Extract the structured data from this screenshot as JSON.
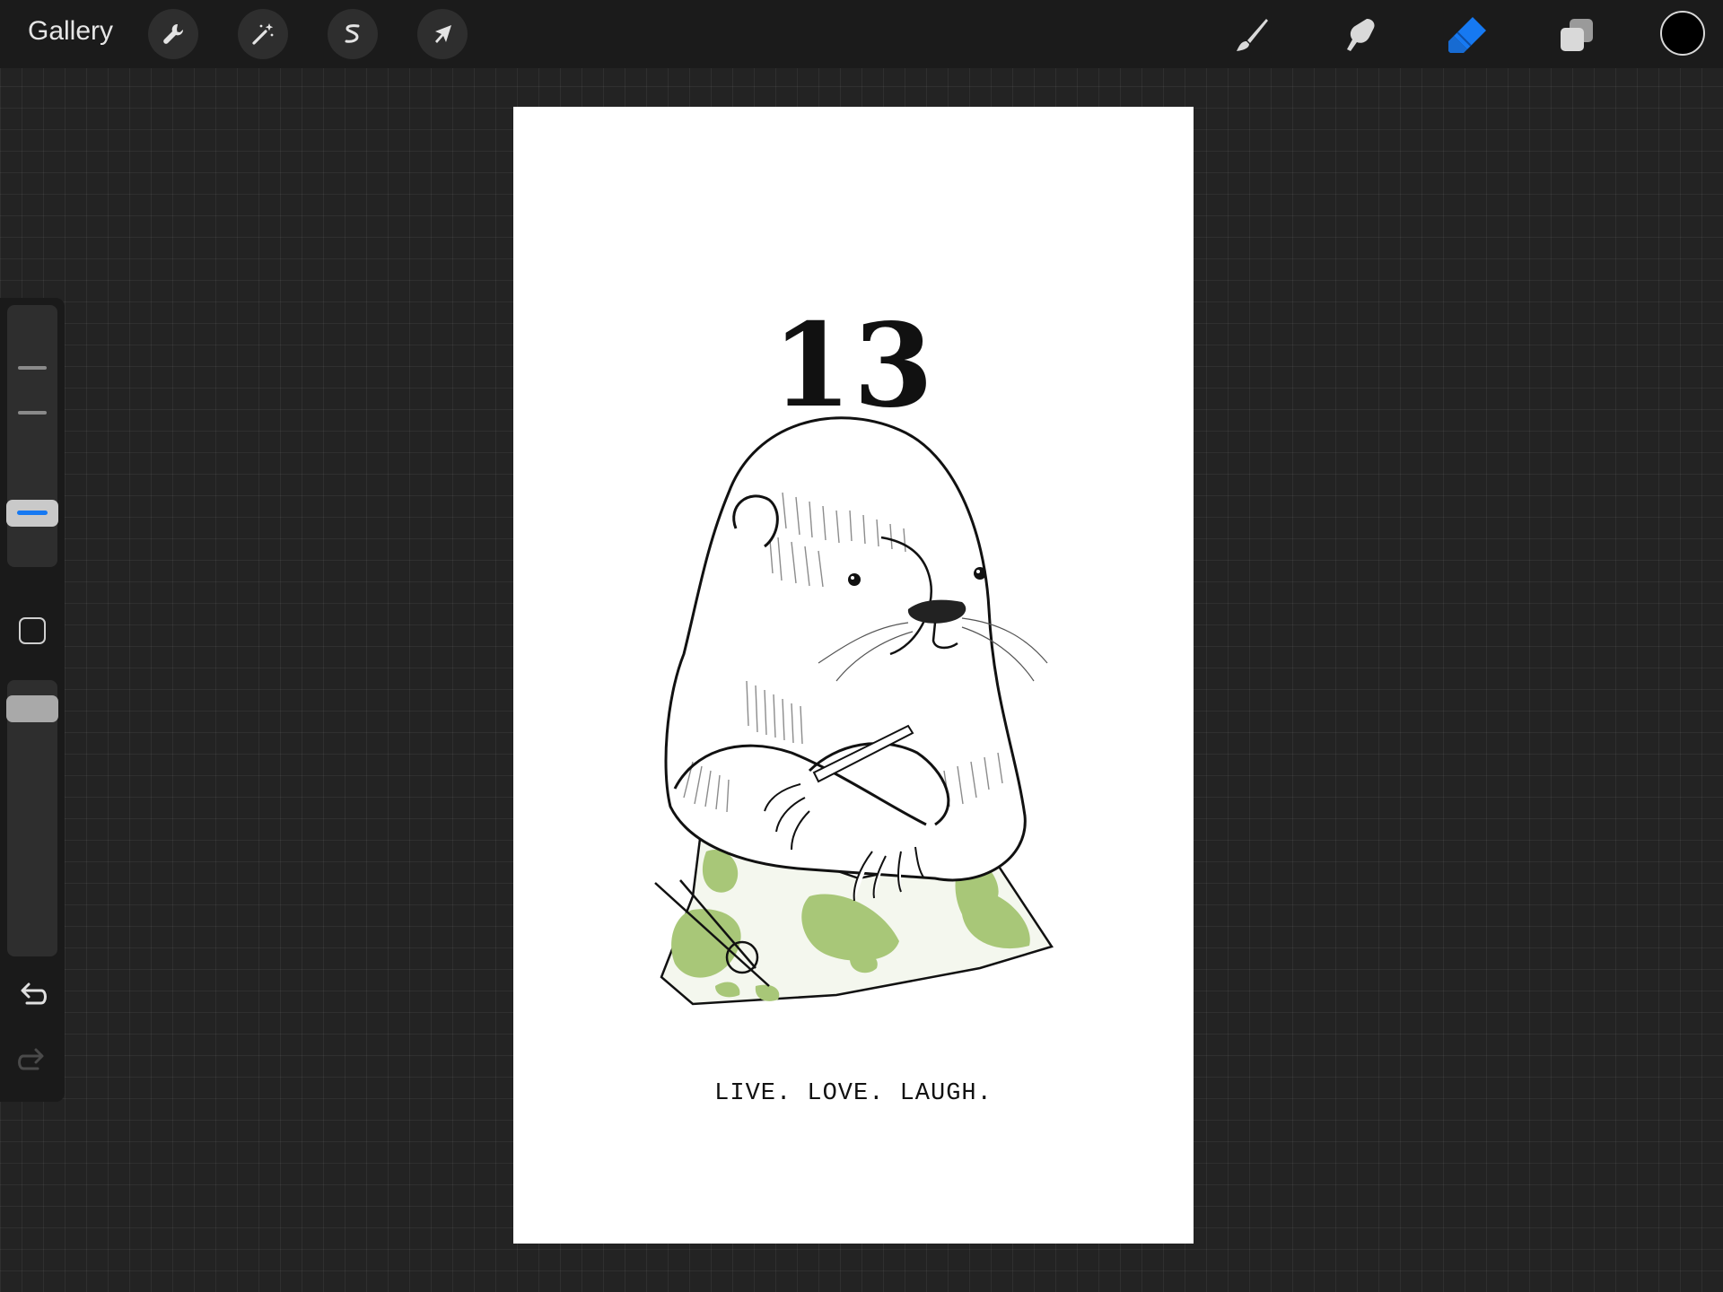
{
  "toolbar": {
    "gallery_label": "Gallery",
    "left_tools": [
      {
        "name": "actions",
        "icon": "wrench-icon"
      },
      {
        "name": "adjustments",
        "icon": "magic-wand-icon"
      },
      {
        "name": "selection",
        "icon": "selection-s-icon"
      },
      {
        "name": "transform",
        "icon": "arrow-cursor-icon"
      }
    ],
    "right_tools": [
      {
        "name": "brush",
        "icon": "brush-icon",
        "active": false
      },
      {
        "name": "smudge",
        "icon": "smudge-icon",
        "active": false
      },
      {
        "name": "eraser",
        "icon": "eraser-icon",
        "active": true
      },
      {
        "name": "layers",
        "icon": "layers-icon",
        "active": false
      }
    ],
    "current_color": "#000000",
    "accent_color": "#1679f2"
  },
  "sidebar": {
    "brush_size_slider": "brush-size",
    "opacity_slider": "opacity",
    "icons": [
      "modify-square-icon",
      "undo-icon",
      "redo-icon"
    ]
  },
  "canvas": {
    "number": "13",
    "caption": "LIVE. LOVE. LAUGH."
  }
}
